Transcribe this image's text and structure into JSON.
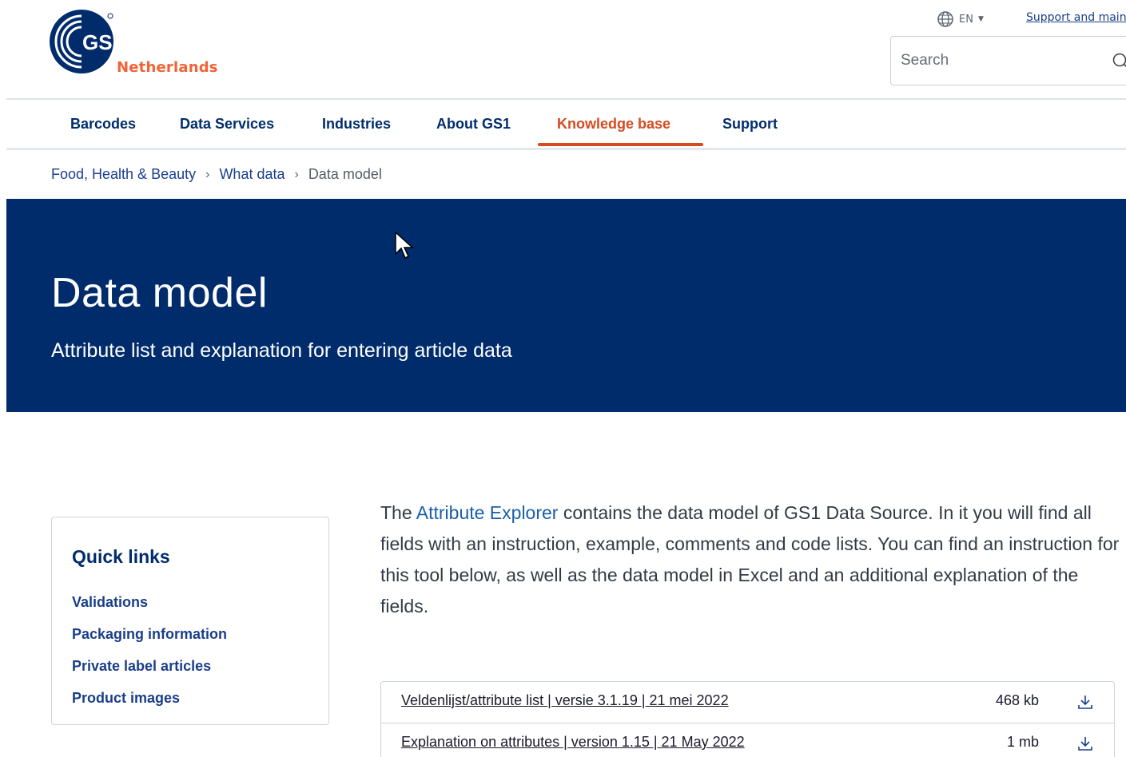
{
  "header": {
    "logo_mark_text": "GS1",
    "logo_region": "Netherlands",
    "language": "EN",
    "support_link": "Support and main",
    "search_placeholder": "Search"
  },
  "nav": {
    "items": [
      {
        "label": "Barcodes"
      },
      {
        "label": "Data Services"
      },
      {
        "label": "Industries"
      },
      {
        "label": "About GS1"
      },
      {
        "label": "Knowledge base"
      },
      {
        "label": "Support"
      }
    ],
    "active_index": 4
  },
  "breadcrumb": {
    "items": [
      "Food, Health & Beauty",
      "What data"
    ],
    "current": "Data model"
  },
  "hero": {
    "title": "Data model",
    "subtitle": "Attribute list and explanation for entering article data"
  },
  "quick_links": {
    "title": "Quick links",
    "items": [
      "Validations",
      "Packaging information",
      "Private label articles",
      "Product images"
    ]
  },
  "intro": {
    "prefix": "The ",
    "link": "Attribute Explorer",
    "suffix": " contains the data model of GS1 Data Source. In it you will find all fields with an instruction, example, comments and code lists. You can find an instruction for this tool below, as well as the data model in Excel and an additional explanation of the fields."
  },
  "downloads": [
    {
      "name": "Veldenlijst/attribute list | versie 3.1.19 | 21 mei 2022",
      "size": "468 kb"
    },
    {
      "name": "Explanation on attributes | version 1.15 | 21 May 2022",
      "size": "1 mb"
    }
  ],
  "icons": {
    "globe": "globe-icon",
    "search": "search-icon",
    "download": "download-icon",
    "cursor": "mouse-cursor-icon"
  },
  "colors": {
    "navy": "#002c6c",
    "accent_orange": "#d64a1f",
    "link_blue": "#1a3e8c"
  }
}
